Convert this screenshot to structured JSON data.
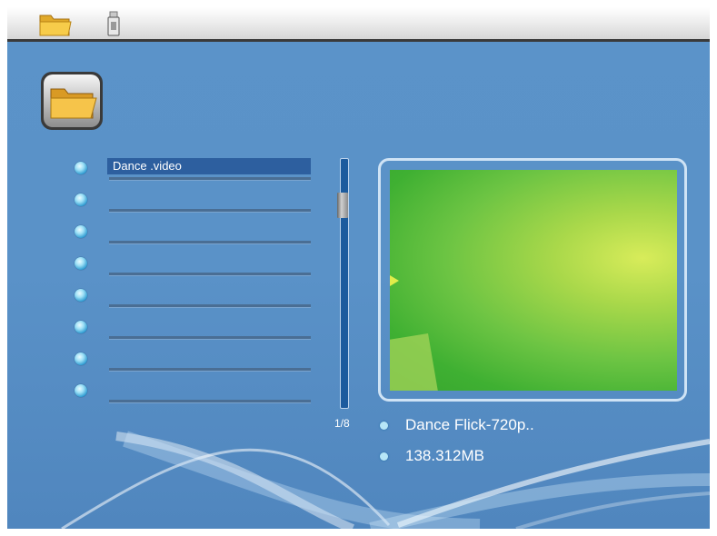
{
  "file_list": {
    "items": [
      {
        "label": "Dance .video",
        "selected": true
      },
      {
        "label": "",
        "selected": false
      },
      {
        "label": "",
        "selected": false
      },
      {
        "label": "",
        "selected": false
      },
      {
        "label": "",
        "selected": false
      },
      {
        "label": "",
        "selected": false
      },
      {
        "label": "",
        "selected": false
      },
      {
        "label": "",
        "selected": false
      }
    ]
  },
  "pagination": {
    "indicator": "1/8"
  },
  "preview": {
    "filename": "Dance Flick-720p..",
    "filesize": "138.312MB"
  },
  "icons": {
    "topbar": [
      "folder-icon",
      "usb-drive-icon"
    ],
    "mode": "folder-icon"
  },
  "colors": {
    "background": "#5a92c8",
    "selection": "#2d5f9f",
    "accent": "#9fe0f6"
  }
}
